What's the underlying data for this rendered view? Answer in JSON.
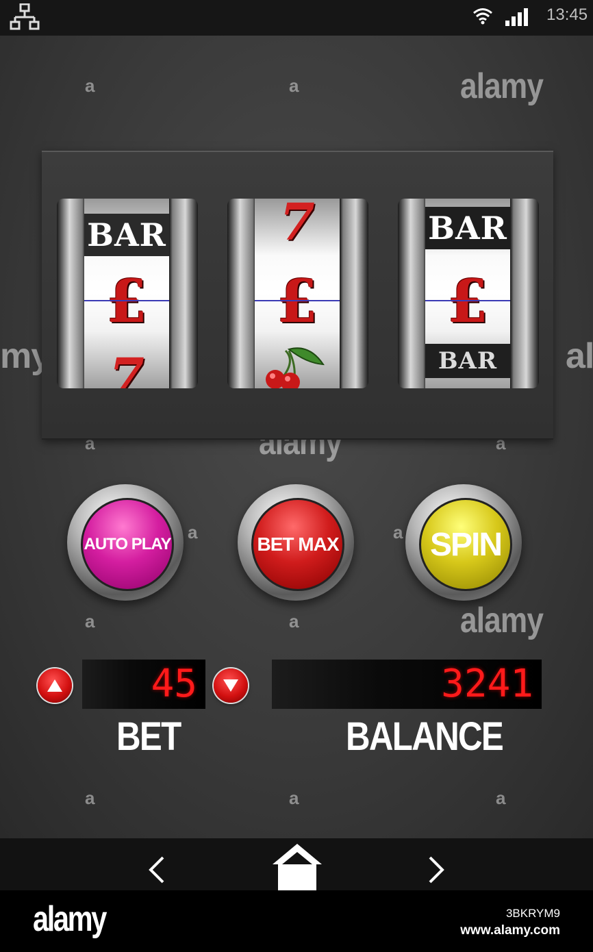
{
  "status_bar": {
    "network_icon": "network-icon",
    "wifi_icon": "wifi-icon",
    "signal_icon": "signal-icon",
    "time": "13:45"
  },
  "reels": [
    {
      "top": "BAR",
      "middle": "£",
      "bottom": "7"
    },
    {
      "top": "7",
      "middle": "£",
      "bottom": "cherry"
    },
    {
      "top": "BAR",
      "middle": "£",
      "bottom": "BAR"
    }
  ],
  "buttons": {
    "auto_play": "AUTO PLAY",
    "bet_max": "BET MAX",
    "spin": "SPIN"
  },
  "bet": {
    "value": "45",
    "label": "BET",
    "increase_icon": "triangle-up-icon",
    "decrease_icon": "triangle-down-icon"
  },
  "balance": {
    "value": "3241",
    "label": "BALANCE"
  },
  "nav": {
    "back_icon": "chevron-left-icon",
    "home_icon": "home-icon",
    "forward_icon": "chevron-right-icon"
  },
  "watermark": {
    "logo": "alamy",
    "letter": "a",
    "partial_left": "my",
    "partial_right": "ala"
  },
  "footer": {
    "logo": "alamy",
    "image_id": "3BKRYM9",
    "url": "www.alamy.com"
  },
  "colors": {
    "led": "#ff1a1a",
    "auto_play": "#d41ea0",
    "bet_max": "#d01c1c",
    "spin": "#d7c81a",
    "symbol_red": "#c81818"
  }
}
